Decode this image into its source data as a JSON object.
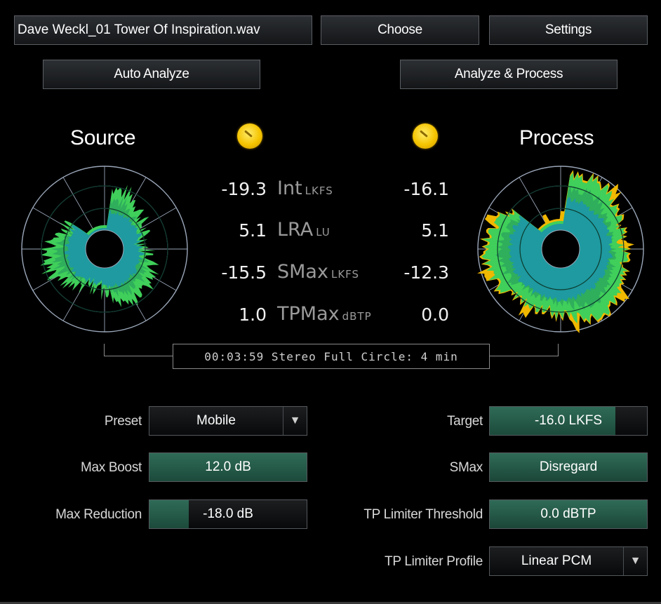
{
  "header": {
    "filename": "Dave Weckl_01 Tower Of Inspiration.wav",
    "choose_label": "Choose",
    "settings_label": "Settings",
    "auto_analyze_label": "Auto Analyze",
    "analyze_process_label": "Analyze & Process"
  },
  "source": {
    "title": "Source"
  },
  "process": {
    "title": "Process"
  },
  "meters": [
    {
      "label": "Int",
      "unit": "LKFS",
      "source": "-19.3",
      "process": "-16.1"
    },
    {
      "label": "LRA",
      "unit": "LU",
      "source": "5.1",
      "process": "5.1"
    },
    {
      "label": "SMax",
      "unit": "LKFS",
      "source": "-15.5",
      "process": "-12.3"
    },
    {
      "label": "TPMax",
      "unit": "dBTP",
      "source": "1.0",
      "process": "0.0"
    }
  ],
  "status_text": "00:03:59 Stereo Full Circle: 4 min",
  "controls": {
    "preset": {
      "label": "Preset",
      "value": "Mobile"
    },
    "max_boost": {
      "label": "Max Boost",
      "value": "12.0 dB",
      "fill_fraction": 1.0
    },
    "max_reduction": {
      "label": "Max Reduction",
      "value": "-18.0 dB",
      "fill_fraction": 0.25
    },
    "target": {
      "label": "Target",
      "value": "-16.0 LKFS",
      "fill_fraction": 0.8
    },
    "smax": {
      "label": "SMax",
      "value": "Disregard"
    },
    "tp_threshold": {
      "label": "TP Limiter Threshold",
      "value": "0.0 dBTP"
    },
    "tp_profile": {
      "label": "TP Limiter Profile",
      "value": "Linear PCM"
    }
  },
  "colors": {
    "accent_green": "#2f6b57",
    "meter_teal": "#1e9aa0",
    "meter_green": "#3fcf5a",
    "meter_yellow": "#f0b800"
  },
  "icons": {
    "indicator": "sun-indicator-icon",
    "dropdown": "triangle-down-icon"
  }
}
